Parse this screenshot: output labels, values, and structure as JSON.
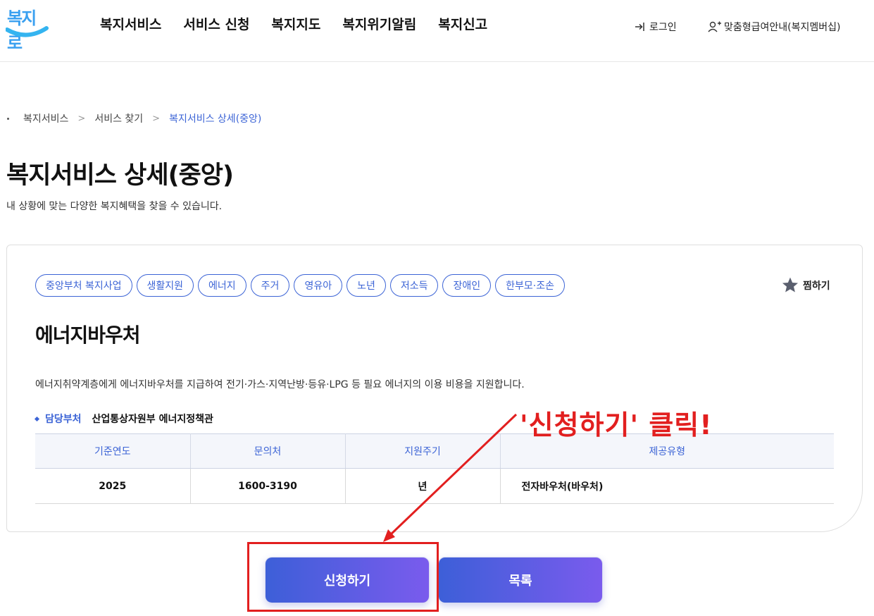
{
  "header": {
    "logo_text": "복지로",
    "nav": [
      "복지서비스",
      "서비스 신청",
      "복지지도",
      "복지위기알림",
      "복지신고"
    ],
    "login_label": "로그인",
    "member_label": "맞춤형급여안내(복지멤버십)"
  },
  "breadcrumb": {
    "items": [
      "복지서비스",
      "서비스 찾기"
    ],
    "current": "복지서비스 상세(중앙)"
  },
  "page": {
    "title": "복지서비스 상세(중앙)",
    "description": "내 상황에 맞는 다양한 복지혜택을 찾을 수 있습니다."
  },
  "service": {
    "tags": [
      "중앙부처 복지사업",
      "생활지원",
      "에너지",
      "주거",
      "영유아",
      "노년",
      "저소득",
      "장애인",
      "한부모·조손"
    ],
    "favorite_label": "찜하기",
    "title": "에너지바우처",
    "description": "에너지취약계층에게 에너지바우처를 지급하여 전기·가스·지역난방·등유·LPG 등 필요 에너지의 이용 비용을 지원합니다.",
    "department_label": "담당부처",
    "department_value": "산업통상자원부 에너지정책관",
    "table": {
      "headers": [
        "기준연도",
        "문의처",
        "지원주기",
        "제공유형"
      ],
      "row": [
        "2025",
        "1600-3190",
        "년",
        "전자바우처(바우처)"
      ]
    }
  },
  "buttons": {
    "apply_label": "신청하기",
    "list_label": "목록"
  },
  "annotation": {
    "text": "'신청하기' 클릭!",
    "color": "#e21f1f"
  },
  "colors": {
    "accent": "#3c64d6",
    "button_gradient_start": "#3d5fd8",
    "button_gradient_end": "#7a5bed"
  }
}
